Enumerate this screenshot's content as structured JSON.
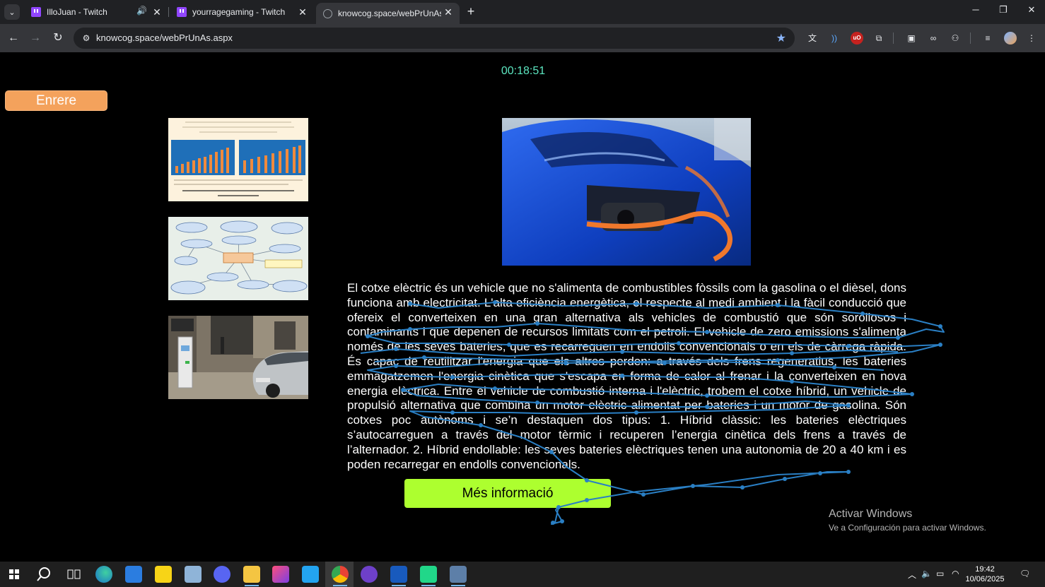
{
  "browser": {
    "tabs": [
      {
        "title": "IlloJuan - Twitch",
        "favicon": "twitch-icon",
        "audio": true
      },
      {
        "title": "yourragegaming - Twitch",
        "favicon": "twitch-icon"
      },
      {
        "title": "knowcog.space/webPrUnAs.aspx",
        "favicon": "globe-icon",
        "active": true
      }
    ],
    "address": "knowcog.space/webPrUnAs.aspx"
  },
  "page": {
    "timer": "00:18:51",
    "back_label": "Enrere",
    "thumbnails": [
      {
        "name": "battery-exercise-image",
        "caption": "I quants hores es necessitaria si la bateria fos de 240 volts amb 90 Ah (ampere/hora)?"
      },
      {
        "name": "concept-map-image",
        "center_label": "COTXES ELÈCTRICS"
      },
      {
        "name": "charging-street-image",
        "sign": "RESTAURANT CAFÉ"
      }
    ],
    "article_text": "El cotxe elèctric és un vehicle que no s'alimenta de combustibles fòssils com la gasolina o el dièsel, dons funciona amb electricitat. L'alta eficiència energètica, el respecte al medi ambient i la fàcil conducció que ofereix el converteixen en una gran alternativa als vehicles de combustió que són sorollosos i contaminants i que depenen de recursos limitats com el petroli. El vehicle de zero emissions s'alimenta només de les seves bateries, que es recarreguen en endolls convencionals o en els de càrrega ràpida. És capaç de reutilitzar l'energia que els altres perden: a través dels frens regeneratius, les bateries emmagatzemen l'energia cinètica que s'escapa en forma de calor al frenar i la converteixen en nova energia elèctrica. Entre el vehicle de combustió interna i l'elèctric, trobem el cotxe híbrid, un vehicle de propulsió alternativa que combina un motor elèctric alimentat per bateries i un motor de gasolina. Són cotxes poc autònoms i se’n destaquen dos tipus: 1. Híbrid clàssic: les bateries elèctriques s’autocarreguen a través del motor tèrmic i recuperen l’energia cinètica dels frens a través de l’alternador. 2. Híbrid endollable: les seves bateries elèctriques tenen una autonomia de 20 a 40 km i es poden recarregar en endolls convencionals.",
    "more_label": "Més informació"
  },
  "watermark": {
    "line1": "Activar Windows",
    "line2": "Ve a Configuración para activar Windows."
  },
  "taskbar": {
    "time": "19:42",
    "date": "10/06/2025"
  },
  "colors": {
    "timer": "#5ce6c0",
    "back_button": "#f4a25c",
    "more_button": "#adff2f",
    "gaze_trace": "#2a7fc4"
  }
}
